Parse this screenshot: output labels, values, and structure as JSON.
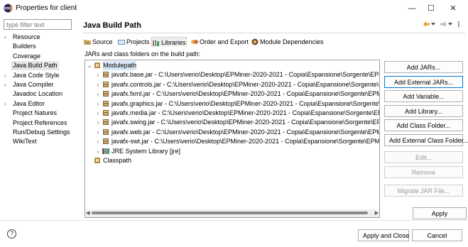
{
  "window": {
    "title": "Properties for client",
    "minimize": "—",
    "maximize": "☐",
    "close": "✕"
  },
  "left": {
    "filter_placeholder": "type filter text",
    "items": [
      {
        "label": "Resource",
        "expandable": true
      },
      {
        "label": "Builders",
        "expandable": false
      },
      {
        "label": "Coverage",
        "expandable": false
      },
      {
        "label": "Java Build Path",
        "expandable": false,
        "selected": true
      },
      {
        "label": "Java Code Style",
        "expandable": true
      },
      {
        "label": "Java Compiler",
        "expandable": true
      },
      {
        "label": "Javadoc Location",
        "expandable": false
      },
      {
        "label": "Java Editor",
        "expandable": true
      },
      {
        "label": "Project Natures",
        "expandable": false
      },
      {
        "label": "Project References",
        "expandable": false
      },
      {
        "label": "Run/Debug Settings",
        "expandable": false
      },
      {
        "label": "WikiText",
        "expandable": false
      }
    ]
  },
  "main": {
    "title": "Java Build Path",
    "tabs": [
      "Source",
      "Projects",
      "Libraries",
      "Order and Export",
      "Module Dependencies"
    ],
    "active_tab": "Libraries",
    "caption": "JARs and class folders on the build path:",
    "tree": {
      "modulepath": "Modulepath",
      "jars": [
        "javafx.base.jar - C:\\Users\\verio\\Desktop\\EPMiner-2020-2021 - Copia\\Espansione\\Sorgente\\EPMiner",
        "javafx.controls.jar - C:\\Users\\verio\\Desktop\\EPMiner-2020-2021 - Copia\\Espansione\\Sorgente\\EPMiner",
        "javafx.fxml.jar - C:\\Users\\verio\\Desktop\\EPMiner-2020-2021 - Copia\\Espansione\\Sorgente\\EPMiner",
        "javafx.graphics.jar - C:\\Users\\verio\\Desktop\\EPMiner-2020-2021 - Copia\\Espansione\\Sorgente\\EPMiner",
        "javafx.media.jar - C:\\Users\\verio\\Desktop\\EPMiner-2020-2021 - Copia\\Espansione\\Sorgente\\EPMiner",
        "javafx.swing.jar - C:\\Users\\verio\\Desktop\\EPMiner-2020-2021 - Copia\\Espansione\\Sorgente\\EPMiner",
        "javafx.web.jar - C:\\Users\\verio\\Desktop\\EPMiner-2020-2021 - Copia\\Espansione\\Sorgente\\EPMiner",
        "javafx-swt.jar - C:\\Users\\verio\\Desktop\\EPMiner-2020-2021 - Copia\\Espansione\\Sorgente\\EPMiner"
      ],
      "jre": "JRE System Library [jre]",
      "classpath": "Classpath"
    },
    "buttons": [
      {
        "label": "Add JARs...",
        "enabled": true
      },
      {
        "label": "Add External JARs...",
        "enabled": true,
        "focused": true
      },
      {
        "label": "Add Variable...",
        "enabled": true
      },
      {
        "label": "Add Library...",
        "enabled": true
      },
      {
        "label": "Add Class Folder...",
        "enabled": true
      },
      {
        "label": "Add External Class Folder...",
        "enabled": true
      },
      {
        "label": "Edit...",
        "enabled": false
      },
      {
        "label": "Remove",
        "enabled": false
      },
      {
        "label": "Migrate JAR File...",
        "enabled": false
      }
    ],
    "apply": "Apply"
  },
  "footer": {
    "help": "?",
    "apply_close": "Apply and Close",
    "cancel": "Cancel"
  },
  "colors": {
    "accent": "#0078d7",
    "selection": "#d9e8f6",
    "disabled_text": "#9a9a9a"
  }
}
